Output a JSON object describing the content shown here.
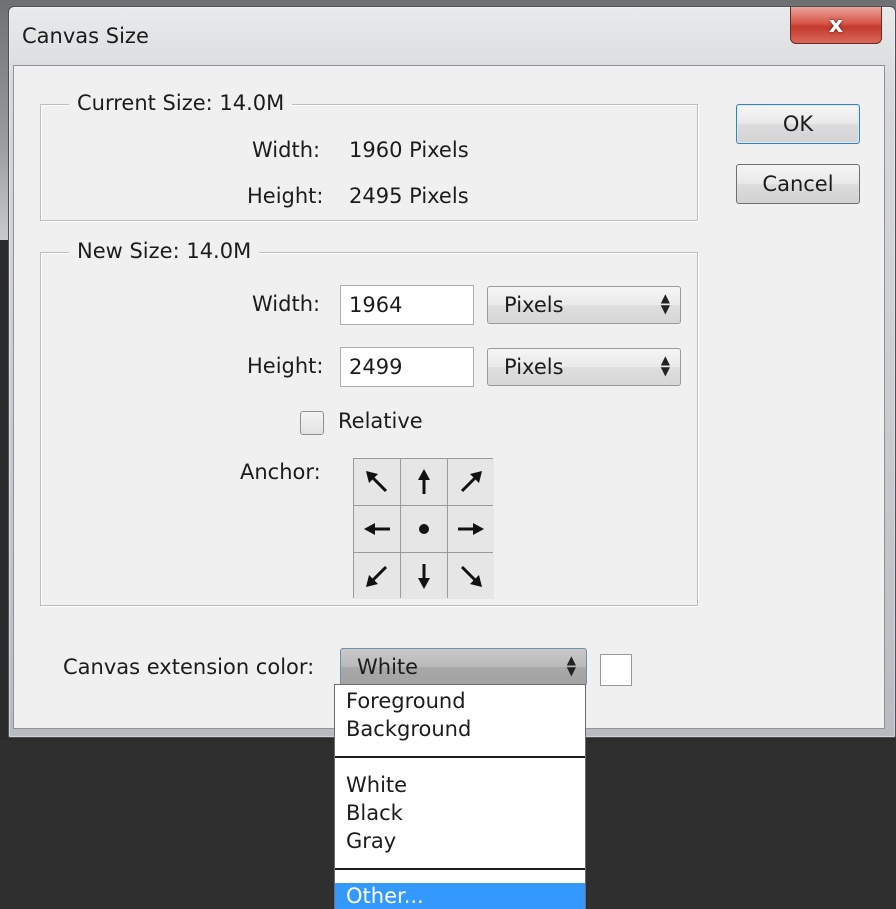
{
  "window": {
    "title": "Canvas Size",
    "close_glyph": "x"
  },
  "current_size": {
    "title": "Current Size: 14.0M",
    "width_label": "Width:",
    "width_value": "1960 Pixels",
    "height_label": "Height:",
    "height_value": "2495 Pixels"
  },
  "new_size": {
    "title": "New Size: 14.0M",
    "width_label": "Width:",
    "width_value": "1964",
    "width_unit": "Pixels",
    "height_label": "Height:",
    "height_value": "2499",
    "height_unit": "Pixels",
    "relative_label": "Relative",
    "relative_checked": false,
    "anchor_label": "Anchor:",
    "anchor_icons": [
      "arrow-up-left-icon",
      "arrow-up-icon",
      "arrow-up-right-icon",
      "arrow-left-icon",
      "anchor-center-dot-icon",
      "arrow-right-icon",
      "arrow-down-left-icon",
      "arrow-down-icon",
      "arrow-down-right-icon"
    ]
  },
  "buttons": {
    "ok": "OK",
    "cancel": "Cancel"
  },
  "extension": {
    "label": "Canvas extension color:",
    "selected": "White",
    "swatch_color": "#ffffff",
    "options_group1": [
      "Foreground",
      "Background"
    ],
    "options_group2": [
      "White",
      "Black",
      "Gray"
    ],
    "options_group3": [
      "Other..."
    ],
    "highlighted": "Other..."
  },
  "colors": {
    "highlight": "#3399ff",
    "close_button": "#c9463a",
    "dialog_bg": "#f0f0f0"
  }
}
